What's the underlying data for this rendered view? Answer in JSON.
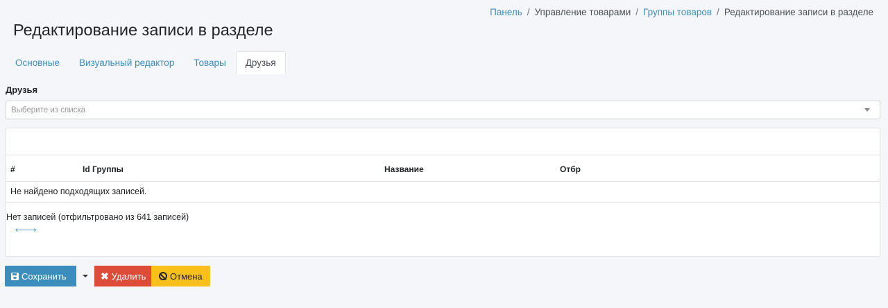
{
  "breadcrumb": {
    "items": [
      {
        "label": "Панель",
        "link": true
      },
      {
        "label": "Управление товарами",
        "link": false
      },
      {
        "label": "Группы товаров",
        "link": true
      },
      {
        "label": "Редактирование записи в разделе",
        "link": false
      }
    ],
    "separator": "/"
  },
  "page": {
    "title": "Редактирование записи в разделе"
  },
  "tabs": [
    {
      "label": "Основные",
      "active": false
    },
    {
      "label": "Визуальный редактор",
      "active": false
    },
    {
      "label": "Товары",
      "active": false
    },
    {
      "label": "Друзья",
      "active": true
    }
  ],
  "friends_field": {
    "label": "Друзья",
    "placeholder": "Выберите из списка"
  },
  "table": {
    "columns": [
      "#",
      "Id Группы",
      "Название",
      "Отбр"
    ],
    "empty_message": "Не найдено подходящих записей.",
    "info": "Нет записей (отфильтровано из 641 записей)",
    "scroll_hint": "⟵⟶"
  },
  "actions": {
    "save": "Сохранить",
    "delete": "Удалить",
    "cancel": "Отмена"
  },
  "colors": {
    "primary": "#3c8dbc",
    "danger": "#dd4b39",
    "warning": "#f9c01a",
    "background": "#f4f6f9"
  }
}
